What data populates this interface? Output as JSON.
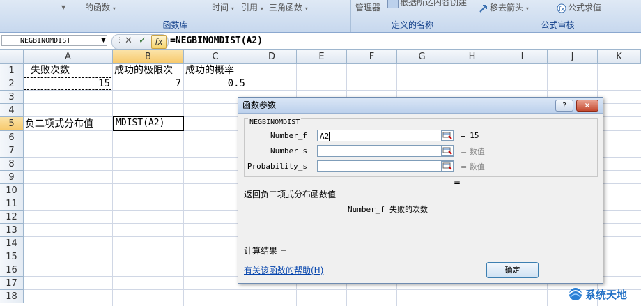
{
  "ribbon": {
    "groups": [
      {
        "caption": "函数库",
        "buttons": [
          "的函数",
          "时间",
          "引用",
          "三角函数"
        ]
      },
      {
        "caption": "定义的名称",
        "buttons": [
          "管理器",
          "根据所选内容创建"
        ]
      },
      {
        "caption": "公式审核",
        "buttons": [
          "移去箭头",
          "公式求值"
        ]
      }
    ]
  },
  "formula_bar": {
    "name_box": "NEGBINOMDIST",
    "formula": "=NEGBINOMDIST(A2)"
  },
  "columns": [
    "A",
    "B",
    "C",
    "D",
    "E",
    "F",
    "G",
    "H",
    "I",
    "J",
    "K"
  ],
  "rows": [
    "1",
    "2",
    "3",
    "4",
    "5",
    "6",
    "7",
    "8",
    "9",
    "10",
    "11",
    "12",
    "13",
    "14",
    "15",
    "16",
    "17",
    "18"
  ],
  "cells": {
    "A1": "失败次数",
    "B1": "成功的极限次",
    "C1": "成功的概率",
    "A2": "15",
    "B2": "7",
    "C2": "0.5",
    "A5": "负二项式分布值",
    "B5": "MDIST(A2)"
  },
  "dialog": {
    "title": "函数参数",
    "function_name": "NEGBINOMDIST",
    "args": [
      {
        "label": "Number_f",
        "value": "A2",
        "result": "15"
      },
      {
        "label": "Number_s",
        "value": "",
        "result": "数值"
      },
      {
        "label": "Probability_s",
        "value": "",
        "result": "数值"
      }
    ],
    "eq": "=",
    "description": "返回负二项式分布函数值",
    "arg_help_name": "Number_f",
    "arg_help_text": "失败的次数",
    "result_label": "计算结果 =",
    "help_link": "有关该函数的帮助(H)",
    "ok_label": "确定",
    "help_button": "?",
    "close_button": "×"
  },
  "watermark": "系统天地"
}
